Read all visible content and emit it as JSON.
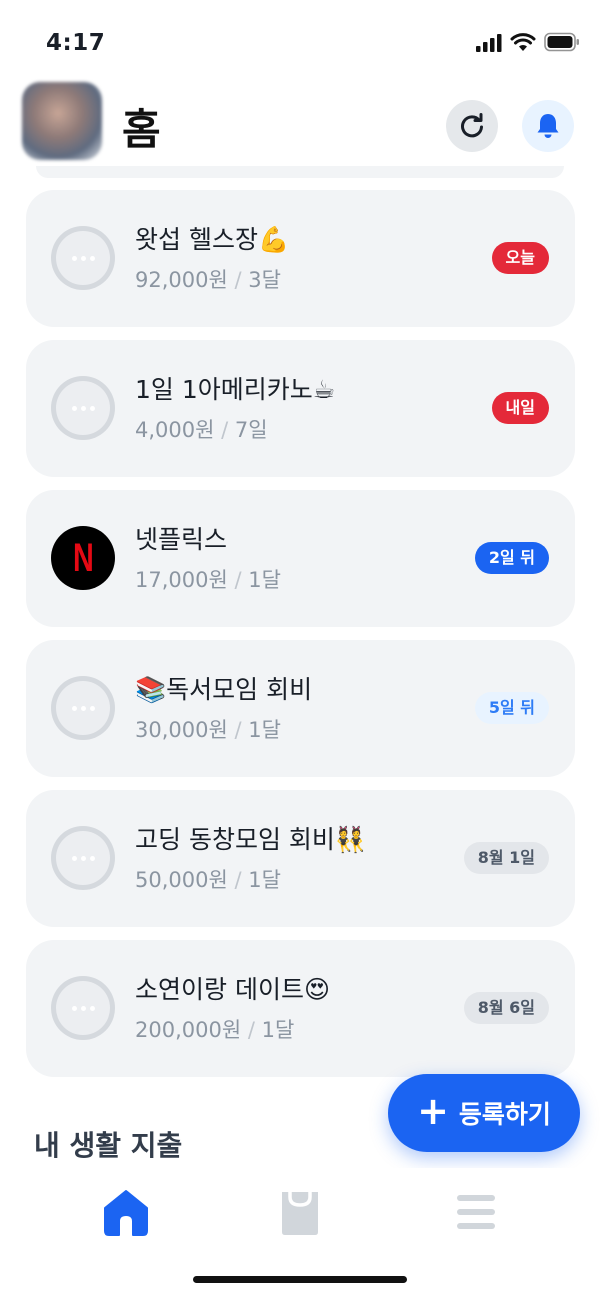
{
  "status_bar": {
    "time": "4:17",
    "icons": [
      "signal-icon",
      "wifi-icon",
      "battery-icon"
    ]
  },
  "header": {
    "title": "홈",
    "avatar": "avatar",
    "actions": [
      "refresh-icon",
      "bell-icon"
    ]
  },
  "subscriptions": [
    {
      "name": "왓섭 헬스장💪",
      "price": "92,000원",
      "cycle": "3달",
      "due": "오늘",
      "icon": "more-dots-icon",
      "badge_style": "red"
    },
    {
      "name": "1일 1아메리카노☕",
      "price": "4,000원",
      "cycle": "7일",
      "due": "내일",
      "icon": "more-dots-icon",
      "badge_style": "red"
    },
    {
      "name": "넷플릭스",
      "price": "17,000원",
      "cycle": "1달",
      "due": "2일 뒤",
      "icon": "netflix-logo",
      "icon_text": "N",
      "badge_style": "blue"
    },
    {
      "name": "📚독서모임 회비",
      "price": "30,000원",
      "cycle": "1달",
      "due": "5일 뒤",
      "icon": "more-dots-icon",
      "badge_style": "lightblue"
    },
    {
      "name": "고딩 동창모임 회비👯",
      "price": "50,000원",
      "cycle": "1달",
      "due": "8월 1일",
      "icon": "more-dots-icon",
      "badge_style": "gray"
    },
    {
      "name": "소연이랑 데이트😍",
      "price": "200,000원",
      "cycle": "1달",
      "due": "8월 6일",
      "icon": "more-dots-icon",
      "badge_style": "gray"
    }
  ],
  "separator": "/",
  "section": {
    "title": "내 생활 지출"
  },
  "fab": {
    "label": "등록하기",
    "icon": "plus-icon"
  },
  "bottom_nav": {
    "items": [
      {
        "name": "home",
        "icon": "home-icon",
        "active": true
      },
      {
        "name": "shopping",
        "icon": "shopping-bag-icon",
        "active": false
      },
      {
        "name": "menu",
        "icon": "menu-icon",
        "active": false
      }
    ]
  },
  "colors": {
    "accent": "#1b64f2",
    "badge_red": "#e42939",
    "card_bg": "#f2f4f6",
    "meta_text": "#8b95a1",
    "inactive_icon": "#d1d6db"
  }
}
